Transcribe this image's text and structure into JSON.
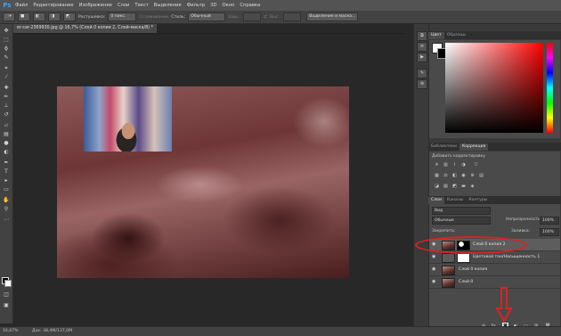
{
  "app": {
    "logo": "Ps"
  },
  "menu": [
    "Файл",
    "Редактирование",
    "Изображение",
    "Слои",
    "Текст",
    "Выделение",
    "Фильтр",
    "3D",
    "Окно",
    "Справка"
  ],
  "options": {
    "feather_label": "Растушевка:",
    "feather_value": "0 пикс.",
    "antialias_label": "Сглаживание",
    "style_label": "Стиль:",
    "style_value": "Обычный",
    "width_label": "Шир.:",
    "height_label": "Выс.:",
    "refine_button": "Выделение и маска..."
  },
  "document": {
    "tab_title": "er-car-2369930.jpg @ 16,7% (Слой 0 копия 2, Слой-маска/8) *"
  },
  "status": {
    "zoom": "16,67%",
    "doc_info": "Док: 38,4M/137,0M"
  },
  "panels": {
    "color_tabs": [
      "Цвет",
      "Образцы"
    ],
    "adj_tabs": [
      "Библиотеки",
      "Коррекция"
    ],
    "adj_title": "Добавить корректировку",
    "layers_tabs": [
      "Слои",
      "Каналы",
      "Контуры"
    ],
    "layers_filter": "Вид",
    "blend_mode": "Обычные",
    "opacity_label": "Непрозрачность:",
    "opacity_value": "100%",
    "lock_label": "Закрепить:",
    "fill_label": "Заливка:",
    "fill_value": "100%"
  },
  "layers": [
    {
      "name": "Слой 0 копия 2",
      "selected": true
    },
    {
      "name": "Цветовой тон/Насыщенность 1",
      "selected": false
    },
    {
      "name": "Слой 0 копия",
      "selected": false
    },
    {
      "name": "Слой 0",
      "selected": false
    }
  ],
  "layer_bottom_icons": [
    "link-icon",
    "fx-icon",
    "mask-icon",
    "adjustment-icon",
    "group-icon",
    "new-layer-icon",
    "trash-icon"
  ],
  "annotation_colors": {
    "highlight": "#e02020"
  }
}
